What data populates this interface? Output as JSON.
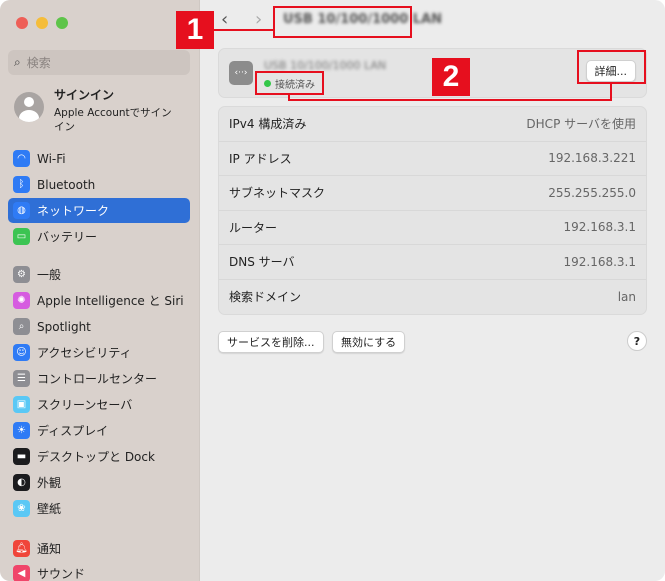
{
  "window": {
    "title": "USB 10/100/1000 LAN"
  },
  "sidebar": {
    "search_placeholder": "検索",
    "account": {
      "name": "サインイン",
      "sub": "Apple Accountでサインイン"
    },
    "items": [
      {
        "label": "Wi-Fi",
        "icon": "wifi-icon",
        "color": "#2f7bf5"
      },
      {
        "label": "Bluetooth",
        "icon": "bluetooth-icon",
        "color": "#2f7bf5"
      },
      {
        "label": "ネットワーク",
        "icon": "globe-icon",
        "color": "#2f7bf5",
        "selected": true
      },
      {
        "label": "バッテリー",
        "icon": "battery-icon",
        "color": "#3cc452"
      },
      {
        "label": "一般",
        "icon": "gear-icon",
        "color": "#8e8e93"
      },
      {
        "label": "Apple Intelligence と Siri",
        "icon": "siri-icon",
        "color": "#d65ce0"
      },
      {
        "label": "Spotlight",
        "icon": "magnifier-icon",
        "color": "#8e8e93"
      },
      {
        "label": "アクセシビリティ",
        "icon": "accessibility-icon",
        "color": "#2f7bf5"
      },
      {
        "label": "コントロールセンター",
        "icon": "control-center-icon",
        "color": "#8e8e93"
      },
      {
        "label": "スクリーンセーバ",
        "icon": "screensaver-icon",
        "color": "#5ac8f5"
      },
      {
        "label": "ディスプレイ",
        "icon": "display-icon",
        "color": "#2f7bf5"
      },
      {
        "label": "デスクトップと Dock",
        "icon": "dock-icon",
        "color": "#1c1c1e"
      },
      {
        "label": "外観",
        "icon": "appearance-icon",
        "color": "#1c1c1e"
      },
      {
        "label": "壁紙",
        "icon": "wallpaper-icon",
        "color": "#5ac8f5"
      },
      {
        "label": "通知",
        "icon": "bell-icon",
        "color": "#f0453a"
      },
      {
        "label": "サウンド",
        "icon": "speaker-icon",
        "color": "#f0456a"
      }
    ]
  },
  "device": {
    "name": "USB 10/100/1000 LAN",
    "status": "接続済み",
    "details_label": "詳細..."
  },
  "info_rows": [
    {
      "label": "IPv4 構成済み",
      "value": "DHCP サーバを使用"
    },
    {
      "label": "IP アドレス",
      "value": "192.168.3.221"
    },
    {
      "label": "サブネットマスク",
      "value": "255.255.255.0"
    },
    {
      "label": "ルーター",
      "value": "192.168.3.1"
    },
    {
      "label": "DNS サーバ",
      "value": "192.168.3.1"
    },
    {
      "label": "検索ドメイン",
      "value": "lan"
    }
  ],
  "buttons": {
    "delete": "サービスを削除...",
    "disable": "無効にする",
    "help": "?"
  },
  "annotations": [
    "1",
    "2"
  ]
}
